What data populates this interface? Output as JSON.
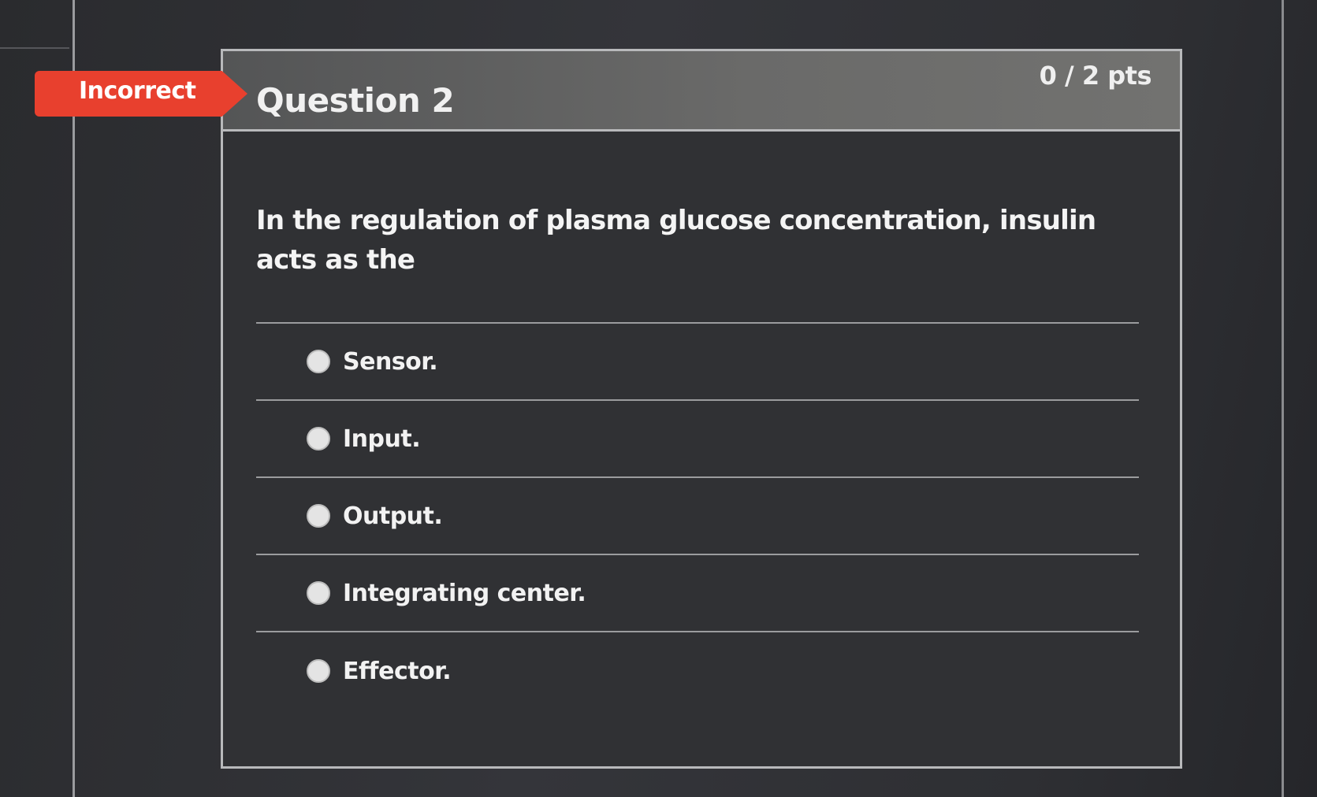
{
  "status": {
    "label": "Incorrect",
    "color": "#e8402e"
  },
  "question": {
    "title": "Question 2",
    "points": "0 / 2 pts",
    "prompt": "In the regulation of plasma glucose concentration, insulin acts as the",
    "answers": [
      {
        "label": "Sensor."
      },
      {
        "label": "Input."
      },
      {
        "label": "Output."
      },
      {
        "label": "Integrating center."
      },
      {
        "label": "Effector."
      }
    ]
  }
}
